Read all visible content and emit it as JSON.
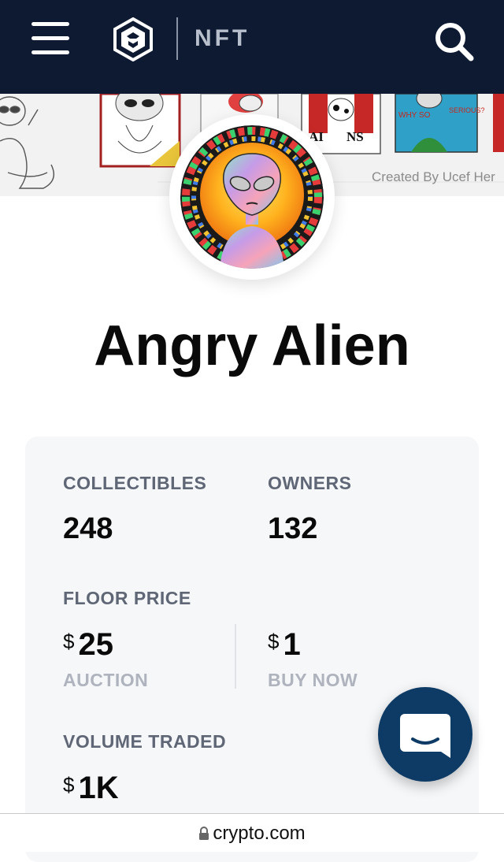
{
  "nav": {
    "menu_icon": "hamburger-menu-icon",
    "logo_icon": "crypto-com-logo-icon",
    "section_label": "NFT",
    "search_icon": "search-icon"
  },
  "banner": {
    "caption": "Created By Ucef Her"
  },
  "collection": {
    "name": "Angry Alien"
  },
  "stats": {
    "collectibles_label": "COLLECTIBLES",
    "collectibles_value": "248",
    "owners_label": "OWNERS",
    "owners_value": "132",
    "floor_price_label": "FLOOR PRICE",
    "auction_currency": "$",
    "auction_value": "25",
    "auction_label": "AUCTION",
    "buynow_currency": "$",
    "buynow_value": "1",
    "buynow_label": "BUY NOW",
    "volume_label": "VOLUME TRADED",
    "volume_currency": "$",
    "volume_value": "1K"
  },
  "browser": {
    "url": "crypto.com"
  },
  "colors": {
    "nav_bg": "#0d1a31",
    "chat_bg": "#0d3b66",
    "card_bg": "#f6f7f9"
  }
}
